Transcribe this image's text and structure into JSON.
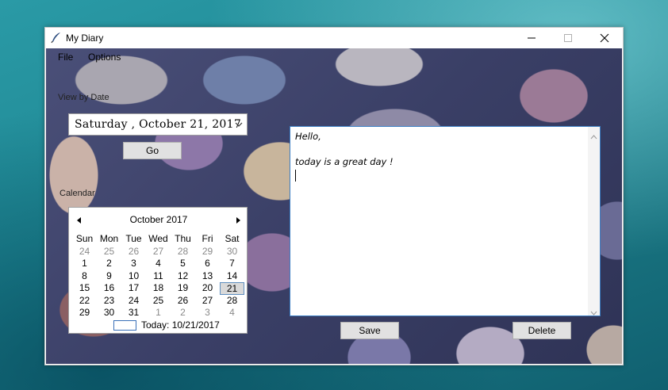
{
  "window": {
    "title": "My Diary",
    "icon": "feather-pen-icon"
  },
  "menu": {
    "file": "File",
    "options": "Options"
  },
  "labels": {
    "view_by_date": "View by Date",
    "calendar": "Calendar"
  },
  "date_picker": {
    "value": "Saturday , October 21, 2017"
  },
  "buttons": {
    "go": "Go",
    "save": "Save",
    "delete": "Delete"
  },
  "calendar": {
    "month_label": "October 2017",
    "weekdays": [
      "Sun",
      "Mon",
      "Tue",
      "Wed",
      "Thu",
      "Fri",
      "Sat"
    ],
    "weeks": [
      [
        "24",
        "25",
        "26",
        "27",
        "28",
        "29",
        "30"
      ],
      [
        "1",
        "2",
        "3",
        "4",
        "5",
        "6",
        "7"
      ],
      [
        "8",
        "9",
        "10",
        "11",
        "12",
        "13",
        "14"
      ],
      [
        "15",
        "16",
        "17",
        "18",
        "19",
        "20",
        "21"
      ],
      [
        "22",
        "23",
        "24",
        "25",
        "26",
        "27",
        "28"
      ],
      [
        "29",
        "30",
        "31",
        "1",
        "2",
        "3",
        "4"
      ]
    ],
    "selected_day": "21",
    "today_label": "Today: 10/21/2017"
  },
  "editor": {
    "lines": [
      "Hello,",
      "",
      "today is a great day !"
    ]
  },
  "colors": {
    "accent": "#3c7fc4",
    "desktop": "#1f8894"
  }
}
